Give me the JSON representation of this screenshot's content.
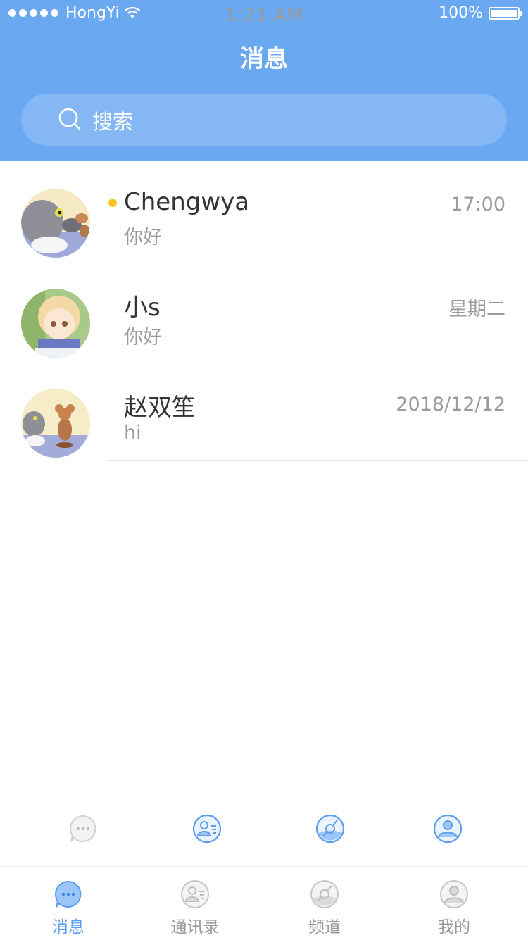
{
  "status_bar": {
    "carrier": "HongYi",
    "time": "1:21 AM",
    "battery": "100%"
  },
  "header": {
    "title": "消息"
  },
  "search": {
    "placeholder": "搜索",
    "icon": "search-icon"
  },
  "conversations": [
    {
      "name": "Chengwya",
      "preview": "你好",
      "time": "17:00",
      "unread": true,
      "avatar": "tom-cat-avatar"
    },
    {
      "name": "小s",
      "preview": "你好",
      "time": "星期二",
      "unread": false,
      "avatar": "anime-boy-avatar"
    },
    {
      "name": "赵双笙",
      "preview": "hi",
      "time": "2018/12/12",
      "unread": false,
      "avatar": "tom-jerry-avatar"
    }
  ],
  "tabs": [
    {
      "label": "消息",
      "icon": "chat-bubble-icon",
      "active": true
    },
    {
      "label": "通讯录",
      "icon": "contacts-icon",
      "active": false
    },
    {
      "label": "频道",
      "icon": "channel-icon",
      "active": false
    },
    {
      "label": "我的",
      "icon": "profile-icon",
      "active": false
    }
  ],
  "colors": {
    "header_blue": "#6aa9f2",
    "accent": "#5b9ef0",
    "unread_dot": "#f7c52b",
    "text_primary": "#333333",
    "text_secondary": "#9a9a9a"
  }
}
